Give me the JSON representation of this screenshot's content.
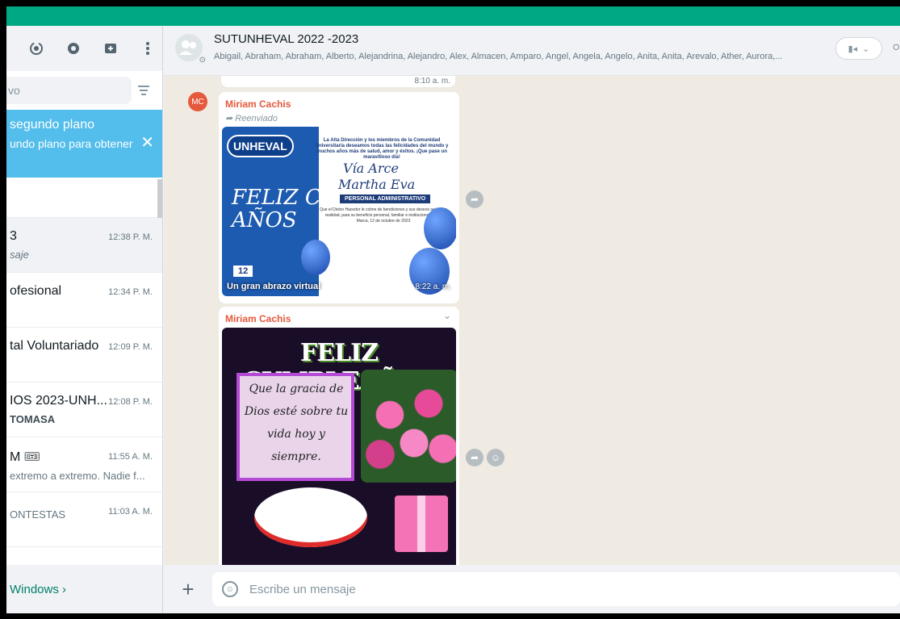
{
  "sidebar": {
    "search_placeholder": "vo",
    "notification": {
      "title": "segundo plano",
      "text": "undo plano para obtener",
      "close": "✕"
    },
    "chats": [
      {
        "name": "3",
        "time": "12:38 P. M.",
        "sub": "saje",
        "style": "italic"
      },
      {
        "name": "ofesional",
        "time": "12:34 P. M.",
        "sub": ""
      },
      {
        "name": "tal Voluntariado",
        "time": "12:09 P. M.",
        "sub": ""
      },
      {
        "name": "IOS 2023-UNH...",
        "time": "12:08 P. M.",
        "sub": "TOMASA",
        "style": "bold"
      },
      {
        "name": "M 🎟",
        "time": "11:55 A. M.",
        "sub": "extremo a extremo. Nadie f..."
      },
      {
        "name": "",
        "time": "11:03 A. M.",
        "sub": "ONTESTAS"
      }
    ],
    "footer": "Windows ›"
  },
  "chat": {
    "title": "SUTUNHEVAL 2022 -2023",
    "members": "Abigail, Abraham, Abraham, Alberto, Alejandrina, Alejandro, Alex, Almacen, Amparo, Angel, Angela, Angelo, Anita, Anita, Arevalo, Ather, Aurora,...",
    "prev_time": "8:10 a. m.",
    "messages": [
      {
        "avatar": "MC",
        "sender": "Miriam Cachis",
        "forwarded": "Reenviado",
        "card": {
          "logo": "UNHEVAL",
          "top_text": "La Alta Dirección y los miembros de la Comunidad Universitaria deseamos todas las felicidades del mundo y muchos años más de salud, amor y éxitos. ¡Que pase un maravilloso día!",
          "name_line1": "Vía Arce",
          "name_line2": "Martha Eva",
          "role": "PERSONAL ADMINISTRATIVO",
          "body": "Que el Divino Hacedor le colme de bendiciones y sus deseos se hagan realidad, para su beneficio personal, familiar e institucional. Pillco Marca, 12 de octubre de 2023",
          "greeting": "FELIZ Cumple AÑOS",
          "date_badge": "12",
          "caption": "Un gran abrazo virtual",
          "time": "8:22 a. m."
        }
      },
      {
        "sender": "Miriam Cachis",
        "card": {
          "title": "FELIZ CUMPLEAÑOS",
          "poem": "Que la gracia de Dios esté sobre tu vida hoy y siempre."
        }
      }
    ]
  },
  "composer": {
    "plus": "+",
    "placeholder": "Escribe un mensaje"
  }
}
